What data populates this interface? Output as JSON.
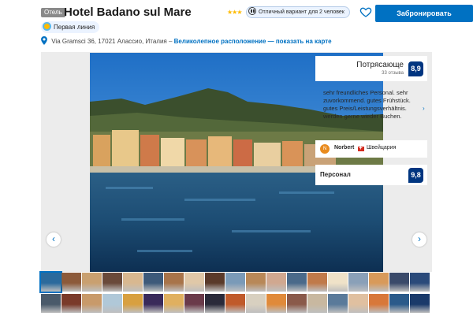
{
  "header": {
    "type_badge": "Отель",
    "hotel_name": "Hotel Badano sul Mare",
    "stars": "★★★",
    "good_choice": "Отличный вариант для 2 человек",
    "reserve_label": "Забронировать",
    "heart_icon": "heart-outline-icon"
  },
  "tag": {
    "label": "Первая линия",
    "icon": "beach-icon"
  },
  "address": {
    "text": "Via Gramsci 36, 17021 Алассио, Италия –",
    "link": "Великолепное расположение — показать на карте"
  },
  "review_panel": {
    "score_word": "Потрясающе",
    "reviews_count": "33 отзыва",
    "score": "8,9",
    "text": "sehr freundliches Personal. sehr zuvorkommend. gutes Frühstück. gutes Preis/Leistungsverhältnis. werden gerne wieder Buchen.",
    "reviewer_initial": "N",
    "reviewer_name": "Norbert",
    "reviewer_country": "Швейцария",
    "staff_label": "Персонал",
    "staff_score": "9,8"
  },
  "gallery": {
    "prev": "‹",
    "next": "›",
    "review_next": "›"
  },
  "colors": {
    "accent": "#0071c2",
    "score_bg": "#003580",
    "star": "#febb02"
  }
}
